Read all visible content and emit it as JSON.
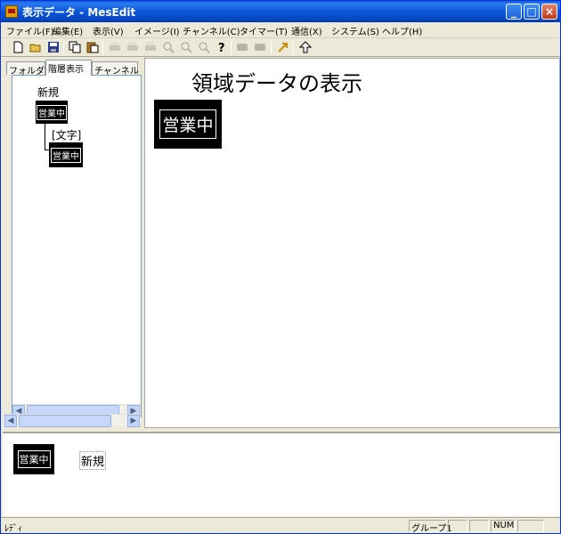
{
  "window": {
    "title": "表示データ - MesEdit",
    "controls": [
      "_",
      "□",
      "×"
    ]
  },
  "menu": {
    "items": [
      "ファイル(F)",
      "編集(E)",
      "表示(V)",
      "イメージ(I)",
      "チャンネル(C)",
      "タイマー(T)",
      "通信(X)",
      "システム(S)",
      "ヘルプ(H)"
    ]
  },
  "toolbar": {
    "icons": [
      "new-file-icon",
      "open-folder-icon",
      "save-icon",
      "copy-icon",
      "paste-icon",
      "print-icon",
      "print-preview-icon",
      "print-setup-icon",
      "zoom-icon",
      "zoom-in-icon",
      "zoom-out-icon",
      "help-icon",
      "stop-icon",
      "pause-icon",
      "jump-icon",
      "up-arrow-icon"
    ]
  },
  "left_panel": {
    "tabs": [
      "フォルダ",
      "階層表示",
      "チャンネル"
    ],
    "active_tab": "階層表示",
    "tree": {
      "root_label": "新規",
      "root_badge": "営業中",
      "child_label": "[文字]",
      "child_badge": "営業中"
    }
  },
  "main": {
    "title": "領域データの表示",
    "badge": "営業中"
  },
  "bottom": {
    "badge": "営業中",
    "label": "新規"
  },
  "status": {
    "text": "ﾚﾃﾞｨ",
    "group": "グループ1",
    "num": "NUM"
  },
  "colors": {
    "titlebar": "#0a56d8",
    "badge_bg": "#000000",
    "badge_fg": "#ffffff"
  }
}
